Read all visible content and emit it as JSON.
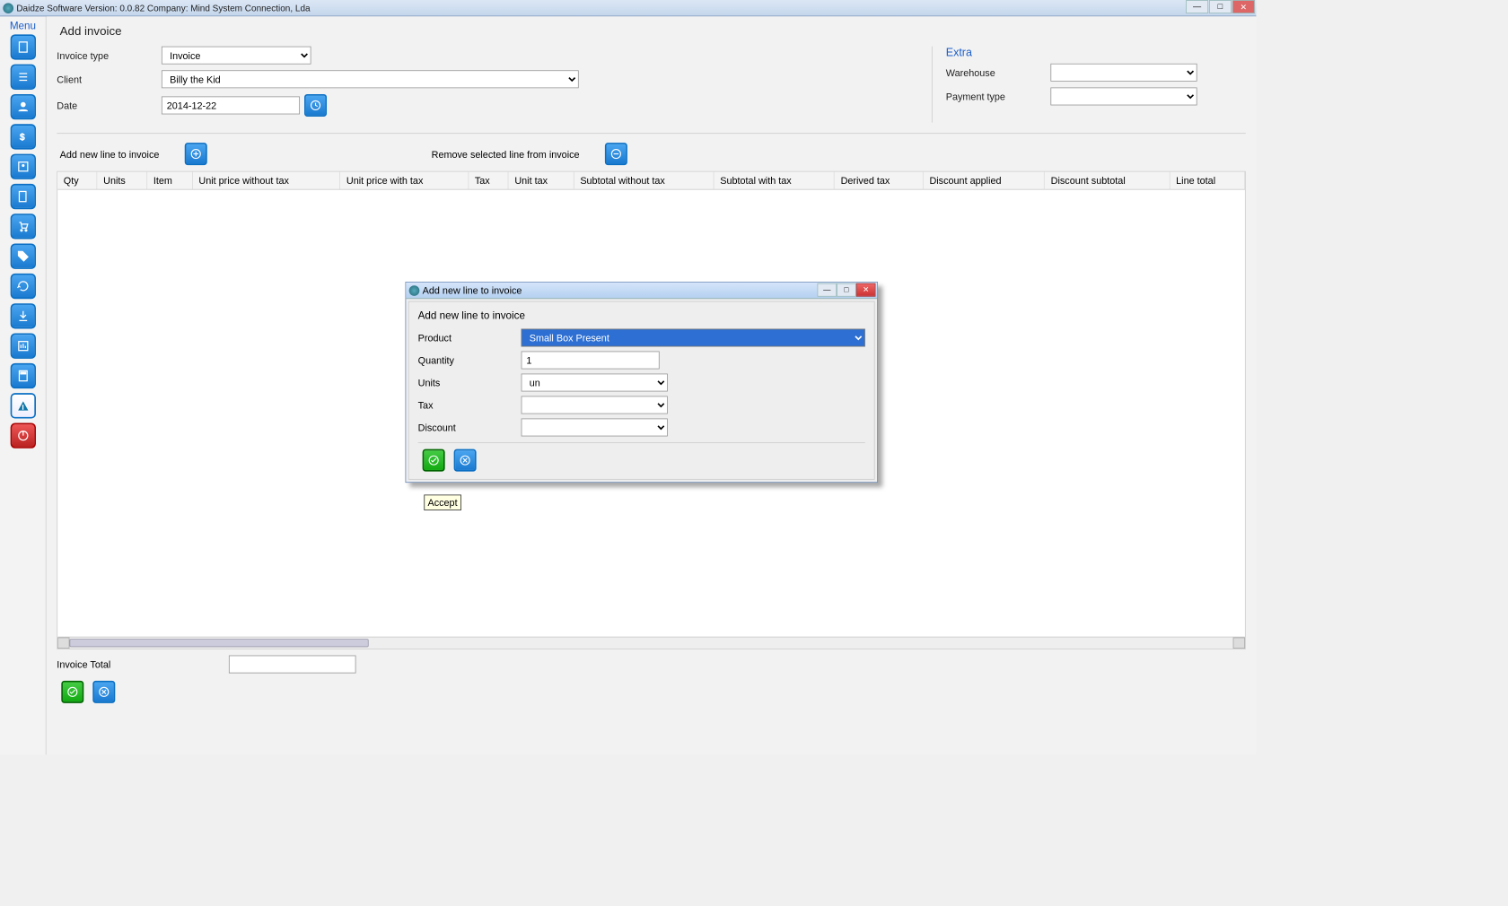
{
  "window": {
    "title": "Daidze Software Version: 0.0.82 Company: Mind System Connection, Lda"
  },
  "sidebar": {
    "menu_label": "Menu"
  },
  "page": {
    "title": "Add invoice",
    "invoice_type_label": "Invoice type",
    "invoice_type_value": "Invoice",
    "client_label": "Client",
    "client_value": "Billy the Kid",
    "date_label": "Date",
    "date_value": "2014-12-22",
    "extra_label": "Extra",
    "warehouse_label": "Warehouse",
    "warehouse_value": "",
    "payment_type_label": "Payment type",
    "payment_type_value": "",
    "add_line_label": "Add new line to invoice",
    "remove_line_label": "Remove selected line from invoice",
    "invoice_total_label": "Invoice Total",
    "invoice_total_value": ""
  },
  "table": {
    "columns": [
      "Qty",
      "Units",
      "Item",
      "Unit price without tax",
      "Unit price with tax",
      "Tax",
      "Unit tax",
      "Subtotal without tax",
      "Subtotal with tax",
      "Derived tax",
      "Discount applied",
      "Discount subtotal",
      "Line total"
    ]
  },
  "dialog": {
    "title": "Add new line to invoice",
    "heading": "Add new line to invoice",
    "product_label": "Product",
    "product_value": "Small Box Present",
    "quantity_label": "Quantity",
    "quantity_value": "1",
    "units_label": "Units",
    "units_value": "un",
    "tax_label": "Tax",
    "tax_value": "",
    "discount_label": "Discount",
    "discount_value": "",
    "tooltip": "Accept"
  }
}
